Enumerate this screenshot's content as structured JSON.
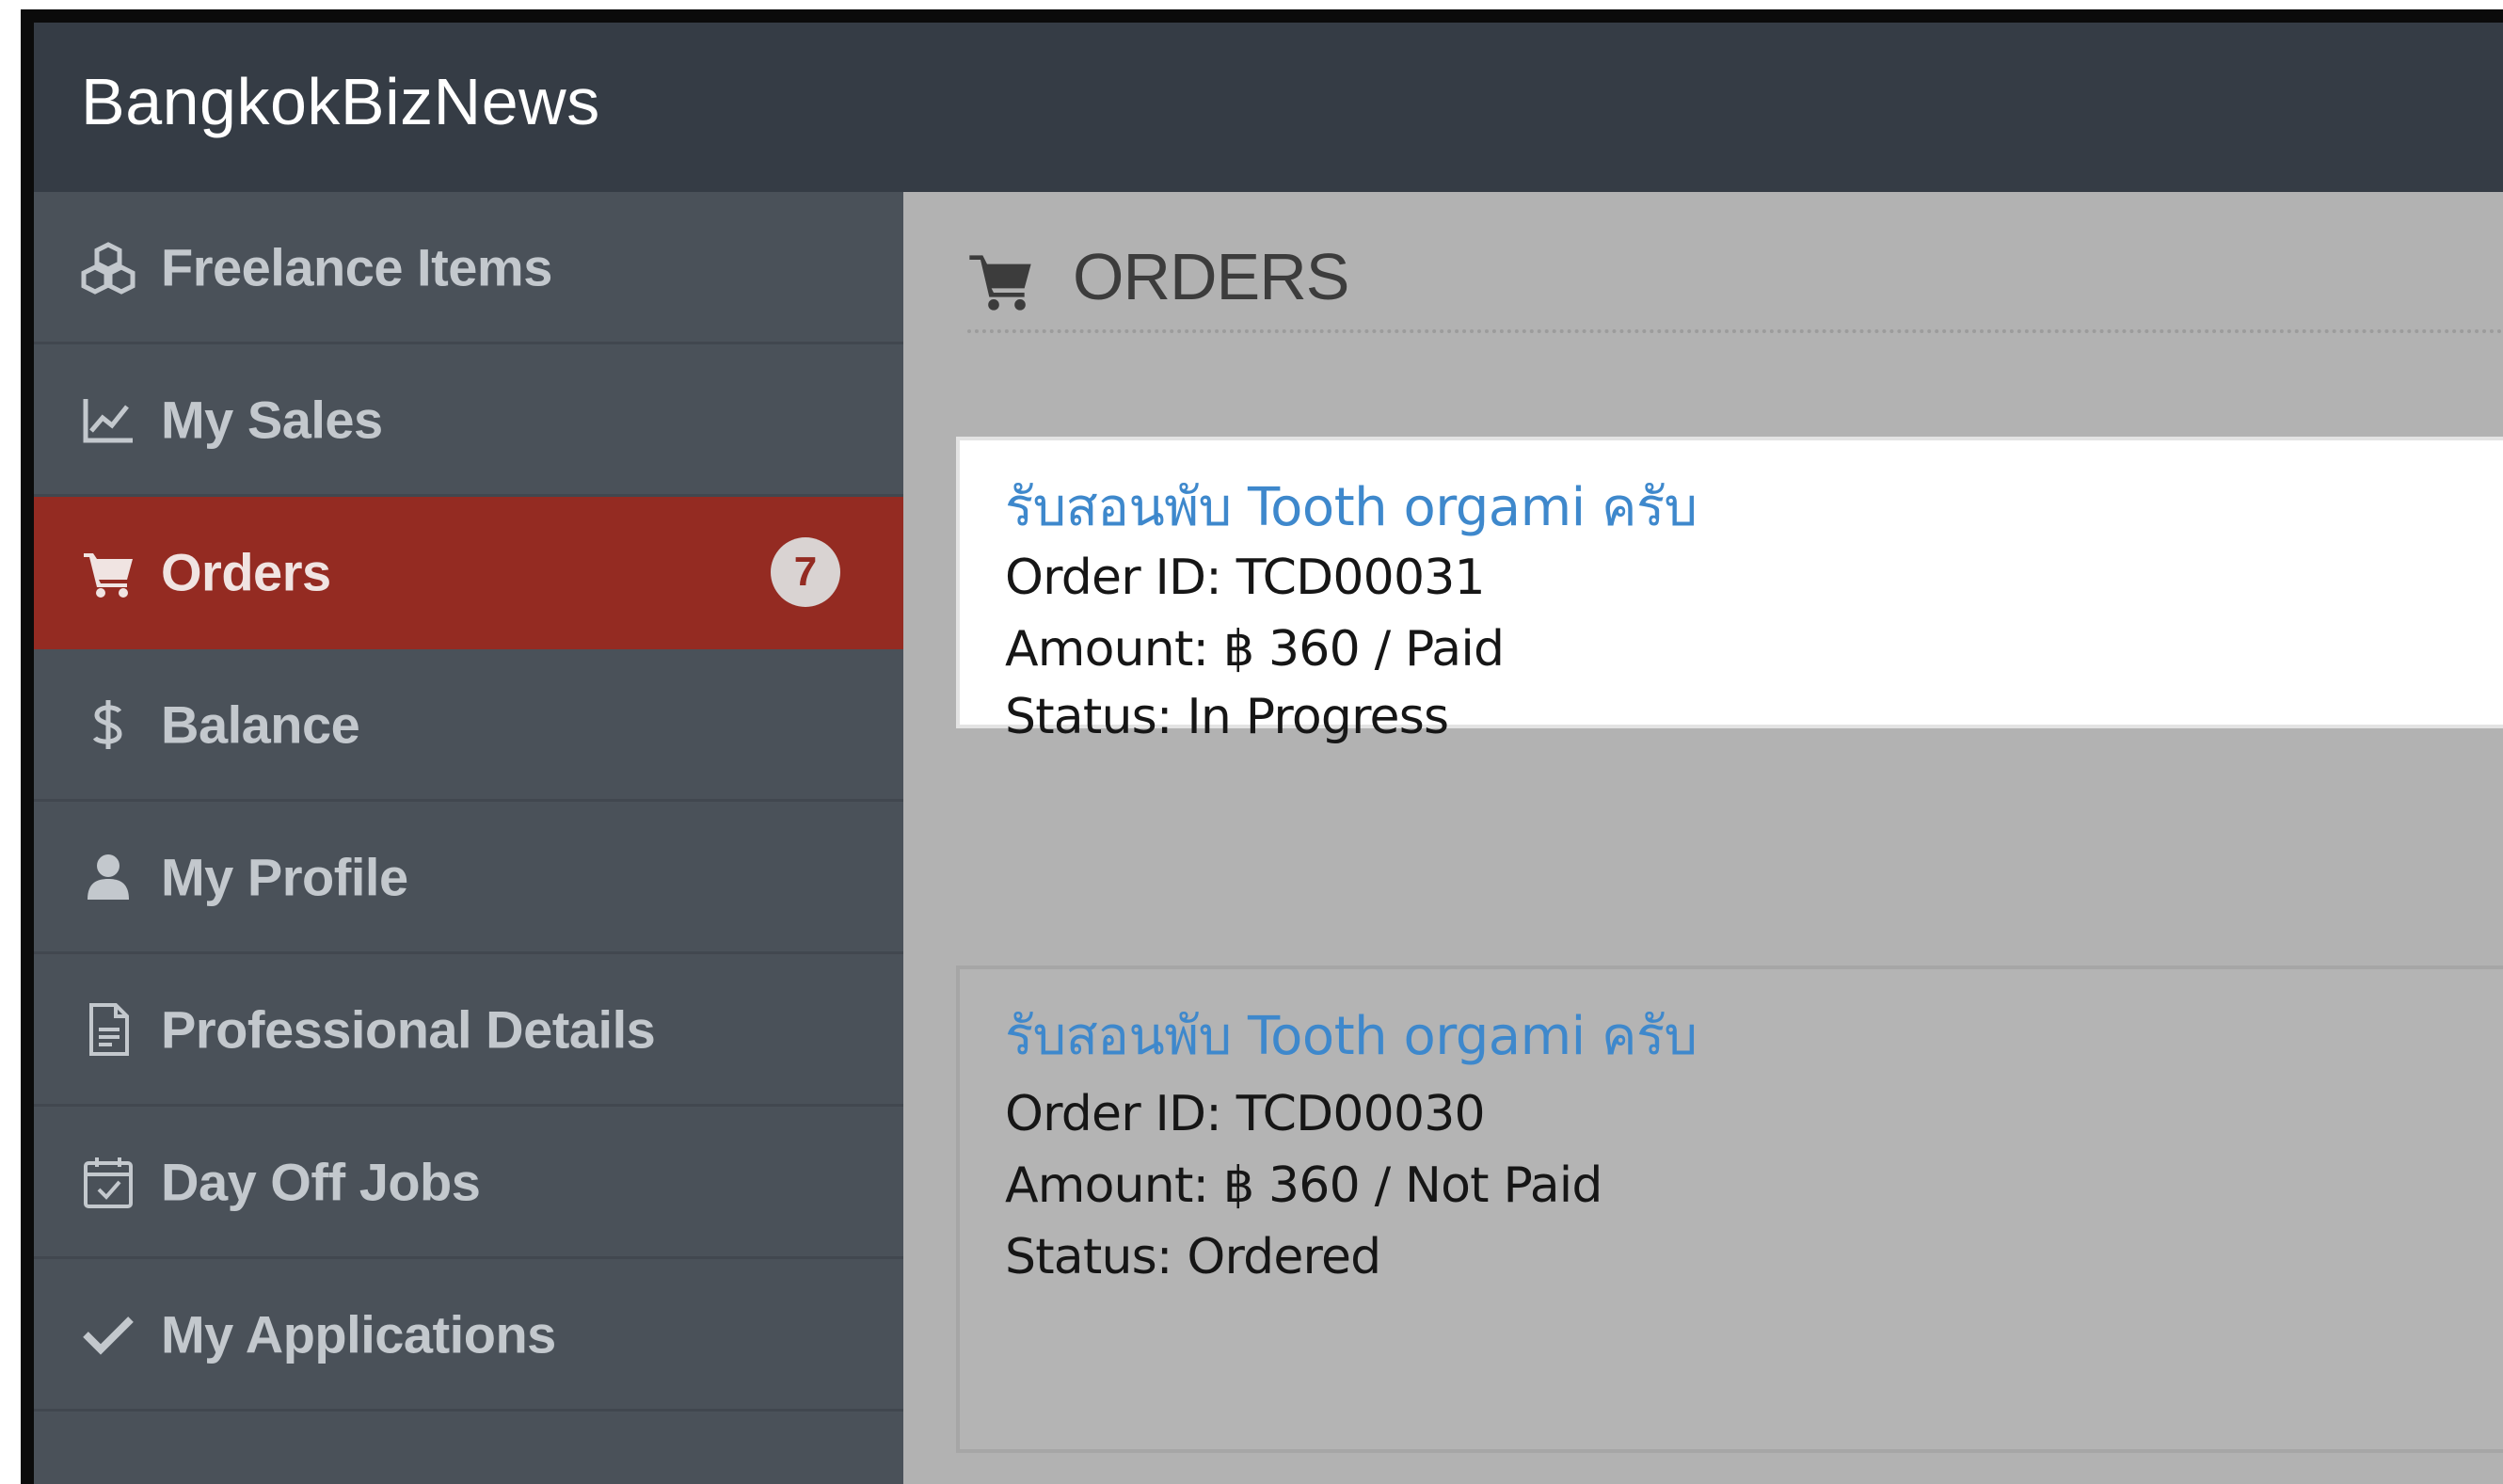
{
  "app": {
    "brand": "BangkokBizNews"
  },
  "sidebar": {
    "items": [
      {
        "label": "Freelance Items",
        "icon": "cubes-icon"
      },
      {
        "label": "My Sales",
        "icon": "line-chart-icon"
      },
      {
        "label": "Orders",
        "icon": "cart-icon",
        "badge": "7",
        "active": true
      },
      {
        "label": "Balance",
        "icon": "dollar-icon"
      },
      {
        "label": "My Profile",
        "icon": "user-icon"
      },
      {
        "label": "Professional Details",
        "icon": "document-icon"
      },
      {
        "label": "Day Off Jobs",
        "icon": "calendar-check-icon"
      },
      {
        "label": "My Applications",
        "icon": "check-icon"
      }
    ]
  },
  "main": {
    "title": "ORDERS",
    "orders": [
      {
        "title": "รับสอนพับ Tooth orgami ครับ",
        "order_id": "Order ID: TCD00031",
        "amount": "Amount: ฿ 360 / Paid",
        "status": "Status: In Progress"
      },
      {
        "title": "รับสอนพับ Tooth orgami ครับ",
        "order_id": "Order ID: TCD00030",
        "amount": "Amount: ฿ 360 / Not Paid",
        "status": "Status: Ordered"
      }
    ]
  },
  "colors": {
    "topbar": "#353c45",
    "sidebar": "#4a5159",
    "active": "#942b22",
    "link": "#3e88cc",
    "content_bg": "#b2b2b2"
  }
}
